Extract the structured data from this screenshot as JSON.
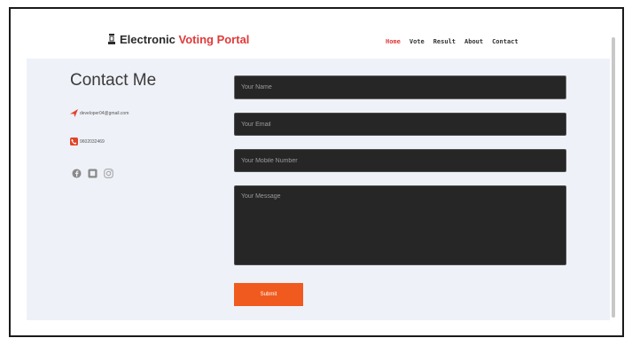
{
  "brand": {
    "prefix": "Electronic",
    "accent": "Voting Portal",
    "accent_color": "#e03a3a",
    "icon": "voting-booth-icon"
  },
  "nav": {
    "items": [
      "Home",
      "Vote",
      "Result",
      "About",
      "Contact"
    ],
    "active": "Home"
  },
  "contact": {
    "title": "Contact Me",
    "email": "developer04@gmail.com",
    "phone": "9602032469",
    "email_icon": "paper-plane-icon",
    "phone_icon": "phone-icon",
    "socials": [
      "facebook-icon",
      "twitter-icon",
      "instagram-icon"
    ]
  },
  "form": {
    "name_placeholder": "Your Name",
    "email_placeholder": "Your Email",
    "mobile_placeholder": "Your Mobile Number",
    "message_placeholder": "Your Message",
    "submit_label": "Submit",
    "submit_color": "#f05a1e"
  }
}
